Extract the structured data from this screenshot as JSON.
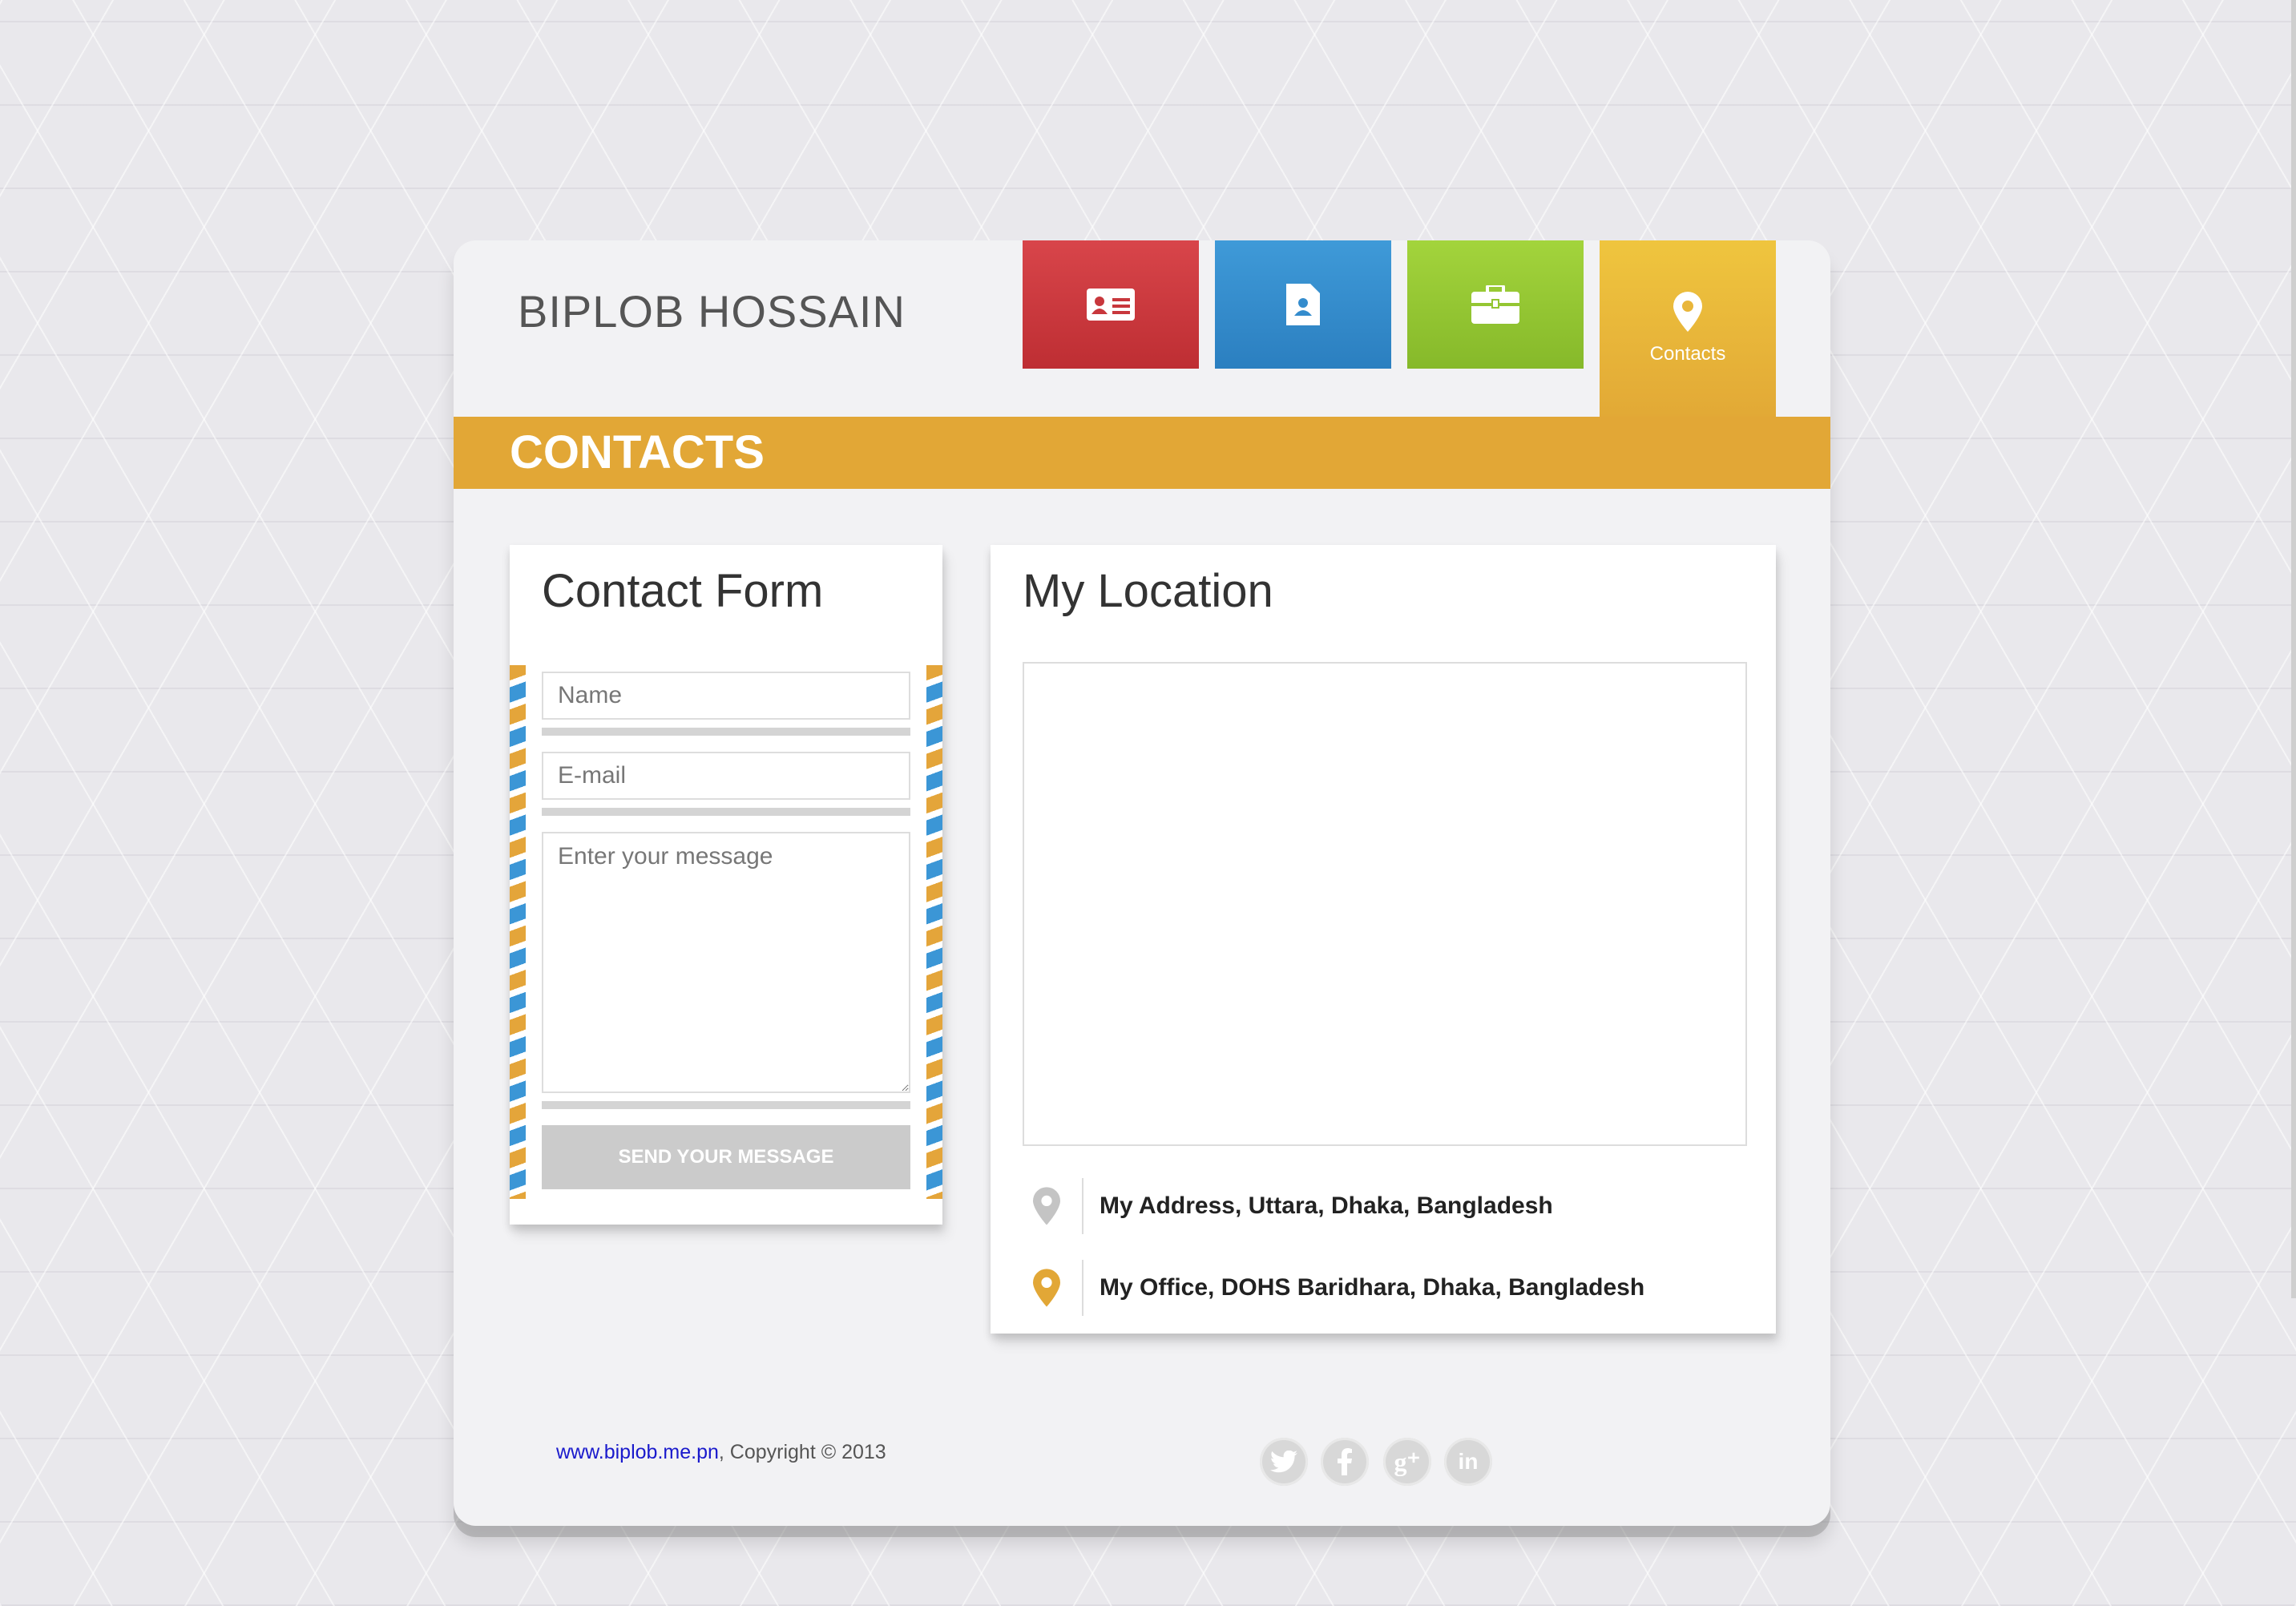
{
  "header": {
    "name": "BIPLOB HOSSAIN"
  },
  "nav": {
    "tiles": [
      {
        "icon": "id-card-icon",
        "label": "",
        "color": "#c8373c"
      },
      {
        "icon": "resume-document-icon",
        "label": "",
        "color": "#348ccd"
      },
      {
        "icon": "briefcase-icon",
        "label": "",
        "color": "#94c632"
      },
      {
        "icon": "map-pin-icon",
        "label": "Contacts",
        "color": "#e9b63a",
        "active": true
      }
    ]
  },
  "banner": {
    "title": "CONTACTS",
    "color": "#e2a736"
  },
  "contact_form": {
    "title": "Contact Form",
    "name_placeholder": "Name",
    "name_value": "",
    "email_placeholder": "E-mail",
    "email_value": "",
    "message_placeholder": "Enter your message",
    "message_value": "",
    "send_label": "SEND YOUR MESSAGE"
  },
  "location": {
    "title": "My Location",
    "addresses": [
      {
        "icon": "gray-pin-icon",
        "text": "My Address, Uttara, Dhaka, Bangladesh"
      },
      {
        "icon": "orange-pin-icon",
        "text": "My Office, DOHS Baridhara, Dhaka, Bangladesh"
      }
    ]
  },
  "footer": {
    "link": "www.biplob.me.pn",
    "copyright": ", Copyright © 2013",
    "social": [
      "twitter-icon",
      "facebook-icon",
      "google-plus-icon",
      "linkedin-icon"
    ]
  }
}
